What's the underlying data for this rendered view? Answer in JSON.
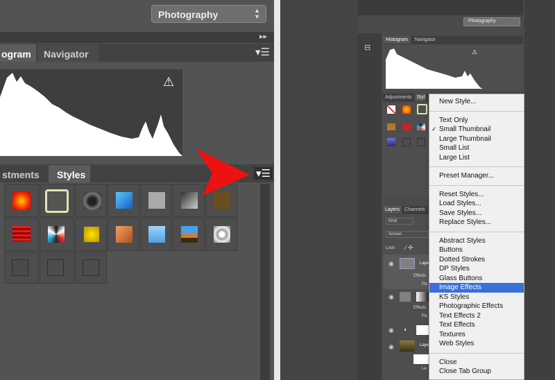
{
  "left": {
    "workspace": "Photography",
    "tabs_top": [
      "ogram",
      "Navigator"
    ],
    "tabs_bottom": [
      "stments",
      "Styles"
    ]
  },
  "right": {
    "workspace": "Photography",
    "tabs_top": [
      "Histogram",
      "Navigator"
    ],
    "tabs_mid": [
      "Adjustments",
      "Styl"
    ],
    "tabs_layers": [
      "Layers",
      "Channels"
    ],
    "kind_label": "Kind",
    "blend_mode": "Screen",
    "lock_label": "Lock:",
    "layer_texts": [
      "Layer",
      "Effects",
      "Pa",
      "Effects",
      "Pa",
      "Layer",
      "Le"
    ]
  },
  "menu": {
    "items": [
      {
        "label": "New Style...",
        "sep_after": true
      },
      {
        "label": "Text Only"
      },
      {
        "label": "Small Thumbnail",
        "checked": true
      },
      {
        "label": "Large Thumbnail"
      },
      {
        "label": "Small List"
      },
      {
        "label": "Large List",
        "sep_after": true
      },
      {
        "label": "Preset Manager...",
        "sep_after": true
      },
      {
        "label": "Reset Styles..."
      },
      {
        "label": "Load Styles..."
      },
      {
        "label": "Save Styles..."
      },
      {
        "label": "Replace Styles...",
        "sep_after": true
      },
      {
        "label": "Abstract Styles"
      },
      {
        "label": "Buttons"
      },
      {
        "label": "Dotted Strokes"
      },
      {
        "label": "DP Styles"
      },
      {
        "label": "Glass Buttons"
      },
      {
        "label": "Image Effects",
        "highlighted": true
      },
      {
        "label": "KS Styles"
      },
      {
        "label": "Photographic Effects"
      },
      {
        "label": "Text Effects 2"
      },
      {
        "label": "Text Effects"
      },
      {
        "label": "Textures"
      },
      {
        "label": "Web Styles",
        "sep_after": true
      },
      {
        "label": "Close"
      },
      {
        "label": "Close Tab Group"
      }
    ]
  },
  "colors": {
    "arrow": "#ee1111",
    "highlight": "#3a6fd8"
  }
}
